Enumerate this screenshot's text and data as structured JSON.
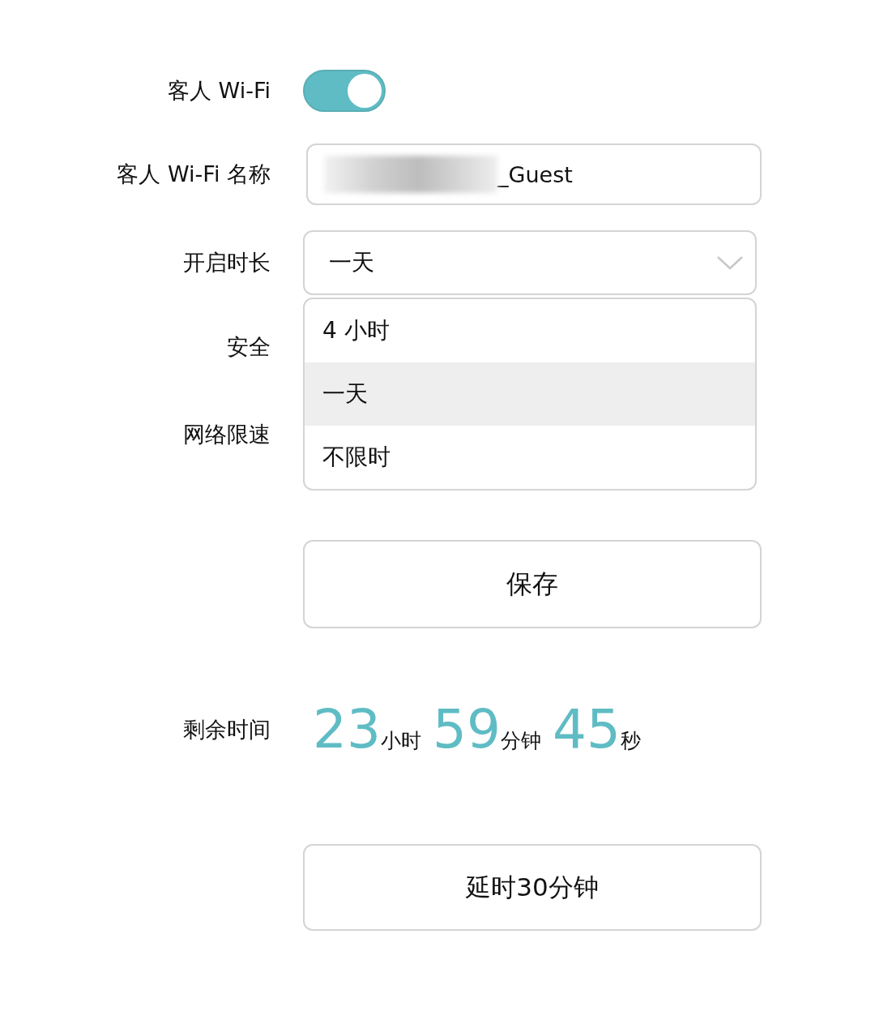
{
  "guest_wifi": {
    "label": "客人 Wi-Fi",
    "on": true
  },
  "ssid": {
    "label": "客人 Wi-Fi 名称",
    "value": "_Guest"
  },
  "duration": {
    "label": "开启时长",
    "value": "一天",
    "expanded": true,
    "options": [
      {
        "label": "4 小时",
        "selected": false
      },
      {
        "label": "一天",
        "selected": true
      },
      {
        "label": "不限时",
        "selected": false
      }
    ]
  },
  "security": {
    "label": "安全"
  },
  "rate_limit": {
    "label": "网络限速"
  },
  "save_button": "保存",
  "remaining": {
    "label": "剩余时间",
    "parts": [
      {
        "value": "23",
        "unit": "小时"
      },
      {
        "value": "59",
        "unit": "分钟"
      },
      {
        "value": "45",
        "unit": "秒"
      }
    ]
  },
  "extend_button": "延时30分钟"
}
